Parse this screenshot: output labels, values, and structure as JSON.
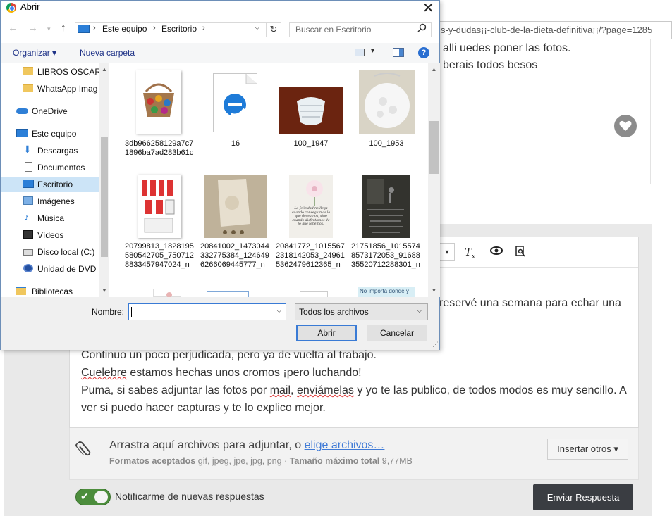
{
  "browser": {
    "url_fragment": "s-y-dudas¡¡-club-de-la-dieta-definitiva¡¡/?page=1285",
    "post_line1": "alli uedes poner las fotos.",
    "post_line2": "berais todos besos"
  },
  "editor": {
    "line_partial": "reservé una semana para echar una",
    "line2": "Continuo un poco perjudicada, pero ya de vuelta al trabajo.",
    "line3_word": "Cuelebre",
    "line3_rest": " estamos hechas unos cromos ¡pero luchando!",
    "line4_a": "Puma, si sabes adjuntar las fotos por ",
    "line4_mail": "mail",
    "line4_b": ", ",
    "line4_enviamelas": "enviámelas",
    "line4_c": " y yo te las publico, de todos modos es muy sencillo. A",
    "line5": "ver si puedo hacer capturas y te lo explico mejor."
  },
  "attach": {
    "main": "Arrastra aquí archivos para adjuntar, o ",
    "link": "elige archivos…",
    "formats_label": "Formatos aceptados",
    "formats_value": " gif, jpeg, jpe, jpg, png · ",
    "max_label": "Tamaño máximo total",
    "max_value": " 9,77MB",
    "insert_button": "Insertar otros ▾"
  },
  "notify_label": "Notificarme de nuevas respuestas",
  "send_button": "Enviar Respuesta",
  "dialog": {
    "title": "Abrir",
    "address": [
      "Este equipo",
      "Escritorio"
    ],
    "search_placeholder": "Buscar en Escritorio",
    "organize": "Organizar ▾",
    "new_folder": "Nueva carpeta",
    "sidebar": [
      {
        "label": "LIBROS OSCAR",
        "icon": "folder-icon"
      },
      {
        "label": "WhatsApp Imag",
        "icon": "folder-icon"
      },
      {
        "label": "OneDrive",
        "icon": "cloud-icon"
      },
      {
        "label": "Este equipo",
        "icon": "computer-icon"
      },
      {
        "label": "Descargas",
        "icon": "download-icon"
      },
      {
        "label": "Documentos",
        "icon": "document-icon"
      },
      {
        "label": "Escritorio",
        "icon": "desktop-icon",
        "selected": true
      },
      {
        "label": "Imágenes",
        "icon": "pictures-icon"
      },
      {
        "label": "Música",
        "icon": "music-icon"
      },
      {
        "label": "Vídeos",
        "icon": "video-icon"
      },
      {
        "label": "Disco local (C:)",
        "icon": "disk-icon"
      },
      {
        "label": "Unidad de DVD R",
        "icon": "dvd-icon"
      },
      {
        "label": "Bibliotecas",
        "icon": "library-icon"
      }
    ],
    "files": [
      "3db966258129a7c71896ba7ad283b61c",
      "16",
      "100_1947",
      "100_1953",
      "20799813_1828195580542705_7507128833457947024_n",
      "20841002_1473044332775384_1246496266069445777_n",
      "20841772_10155672318142053_249615362479612365_n",
      "21751856_10155748573172053_9168835520712288301_n"
    ],
    "quote1": "La felicidad no llega cuando conseguimos lo que deseamos, sino cuando disfrutamos de lo que tenemos.",
    "quote2_partial": "No importa donde y",
    "name_label": "Nombre:",
    "file_type": "Todos los archivos",
    "open_button": "Abrir",
    "cancel_button": "Cancelar"
  }
}
